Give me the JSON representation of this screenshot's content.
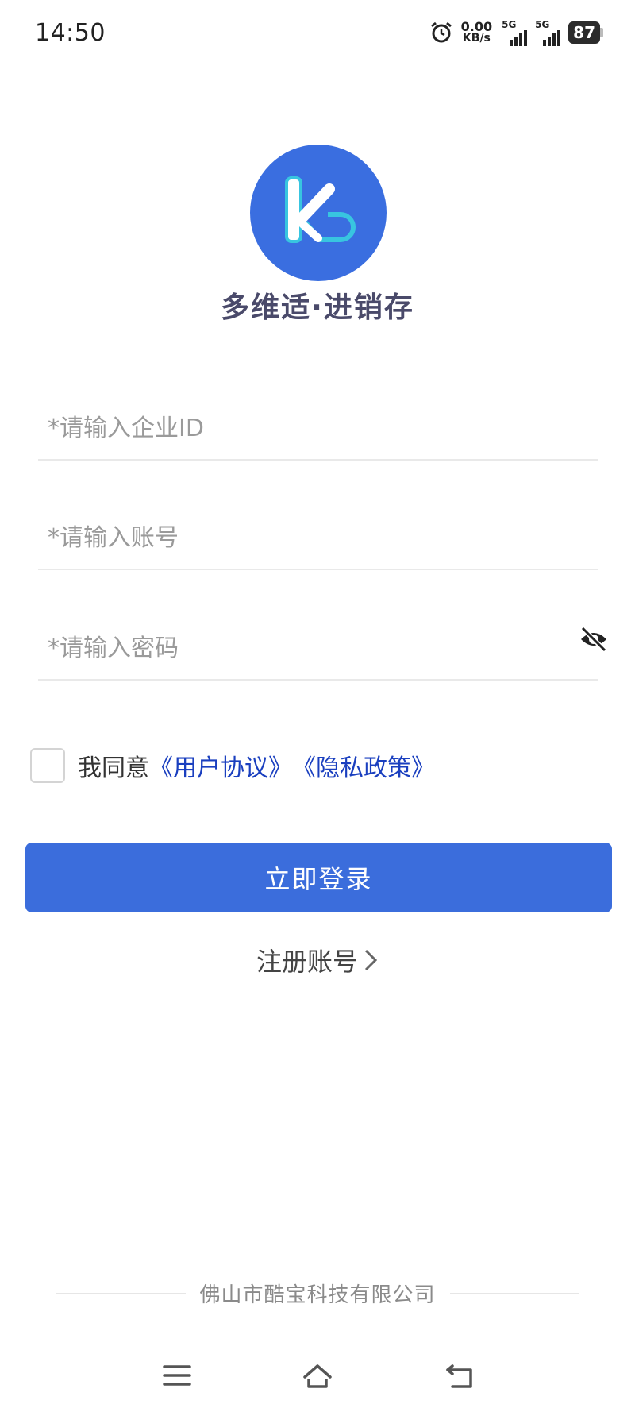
{
  "status_bar": {
    "time": "14:50",
    "net_speed_value": "0.00",
    "net_speed_unit": "KB/s",
    "sim1_type": "5G",
    "sim2_type": "5G",
    "battery_level": "87",
    "alarm_icon": "alarm-clock-icon"
  },
  "app": {
    "logo_icon": "k-logo",
    "logo_color": "#3a6ee0",
    "title": "多维适·进销存"
  },
  "form": {
    "company_id_placeholder": "*请输入企业ID",
    "company_id_value": "",
    "account_placeholder": "*请输入账号",
    "account_value": "",
    "password_placeholder": "*请输入密码",
    "password_value": "",
    "password_toggle_icon": "eye-off-icon"
  },
  "agreement": {
    "checked": false,
    "prefix": "我同意",
    "user_agreement": "《用户协议》",
    "privacy_policy": "《隐私政策》",
    "link_color": "#1a3fbf"
  },
  "actions": {
    "login_label": "立即登录",
    "register_label": "注册账号",
    "accent_color": "#3b6ddc"
  },
  "footer": {
    "company": "佛山市酷宝科技有限公司"
  },
  "nav_bar": {
    "menu_icon": "menu-icon",
    "home_icon": "home-icon",
    "back_icon": "back-icon"
  }
}
